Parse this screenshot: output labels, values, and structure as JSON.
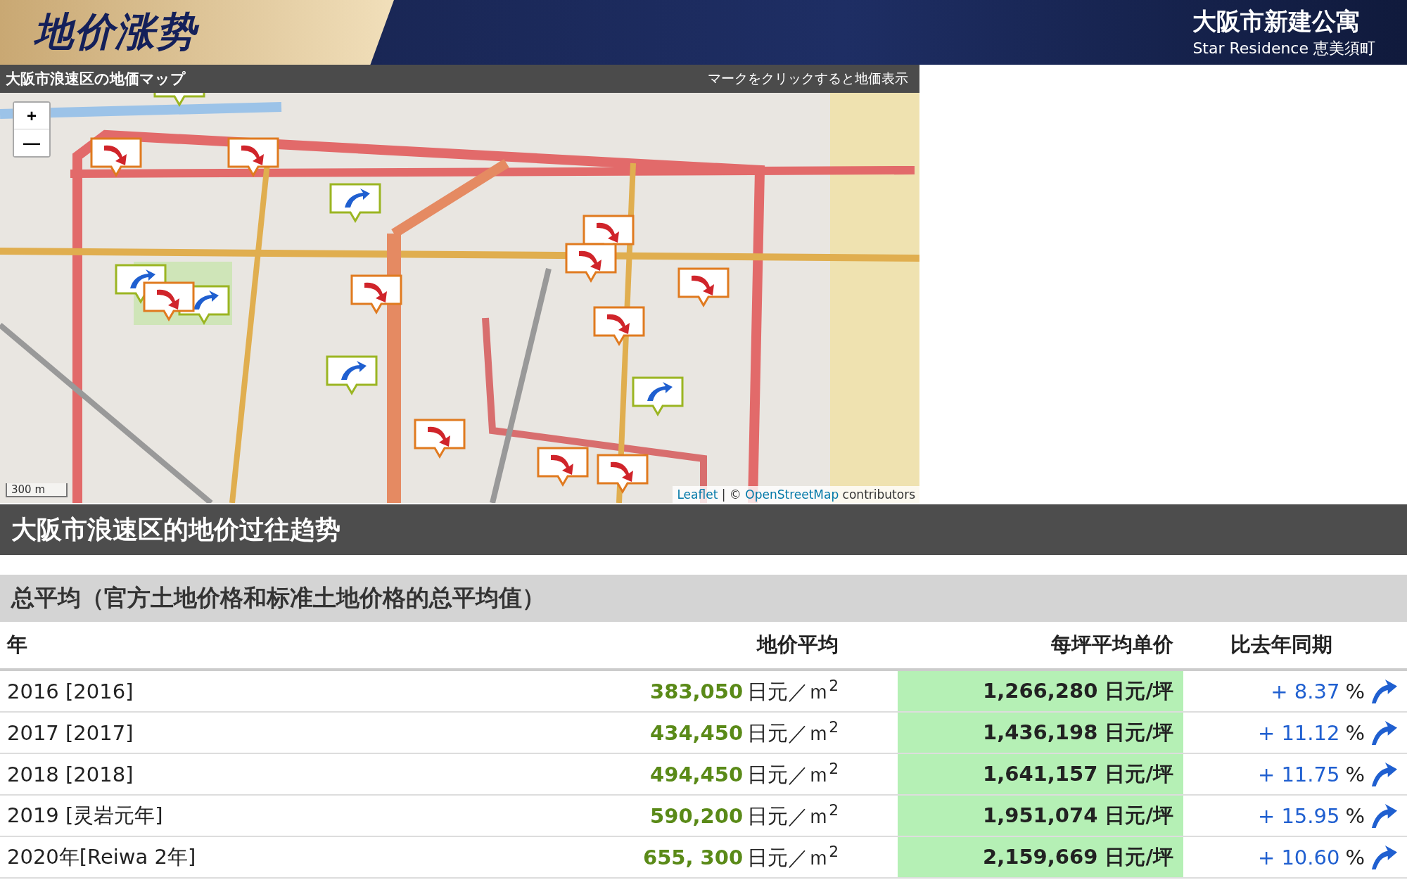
{
  "header": {
    "title": "地价涨势",
    "brand": "大阪市新建公寓",
    "subtitle": "Star Residence 恵美須町"
  },
  "map": {
    "title": "大阪市浪速区の地価マップ",
    "hint": "マークをクリックすると地価表示",
    "zoom_in": "+",
    "zoom_out": "—",
    "scale": "300 m",
    "attribution_link": "Leaflet",
    "attribution_sep": " | © ",
    "attribution_osm": "OpenStreetMap",
    "attribution_rest": " contributors"
  },
  "section_title": "大阪市浪速区的地价过往趋势",
  "table": {
    "caption": "总平均（官方土地价格和标准土地价格的总平均值）",
    "columns": [
      "年",
      "地价平均",
      "每坪平均单价",
      "比去年同期"
    ],
    "rows": [
      {
        "year": "2016 [2016]",
        "price": "383,050",
        "price_unit": "日元／ｍ$^{2}$",
        "tsubo": "1,266,280 日元/坪",
        "change": "+ 8.37",
        "pct": "%"
      },
      {
        "year": "2017 [2017]",
        "price": "434,450",
        "price_unit": "日元／ｍ$^{2}$",
        "tsubo": "1,436,198 日元/坪",
        "change": "+ 11.12",
        "pct": "%"
      },
      {
        "year": "2018 [2018]",
        "price": "494,450",
        "price_unit": "日元／ｍ$^{2}$",
        "tsubo": "1,641,157 日元/坪",
        "change": "+ 11.75",
        "pct": "%"
      },
      {
        "year": "2019 [灵岩元年]",
        "price": "590,200",
        "price_unit": "日元／ｍ$^{2}$",
        "tsubo": "1,951,074 日元/坪",
        "change": "+ 15.95",
        "pct": "%"
      },
      {
        "year": "2020年[Reiwa 2年]",
        "price": "655, 300",
        "price_unit": "日元／ｍ$^{2}$",
        "tsubo": "2,159,669 日元/坪",
        "change": "+ 10.60",
        "pct": "%"
      }
    ]
  }
}
